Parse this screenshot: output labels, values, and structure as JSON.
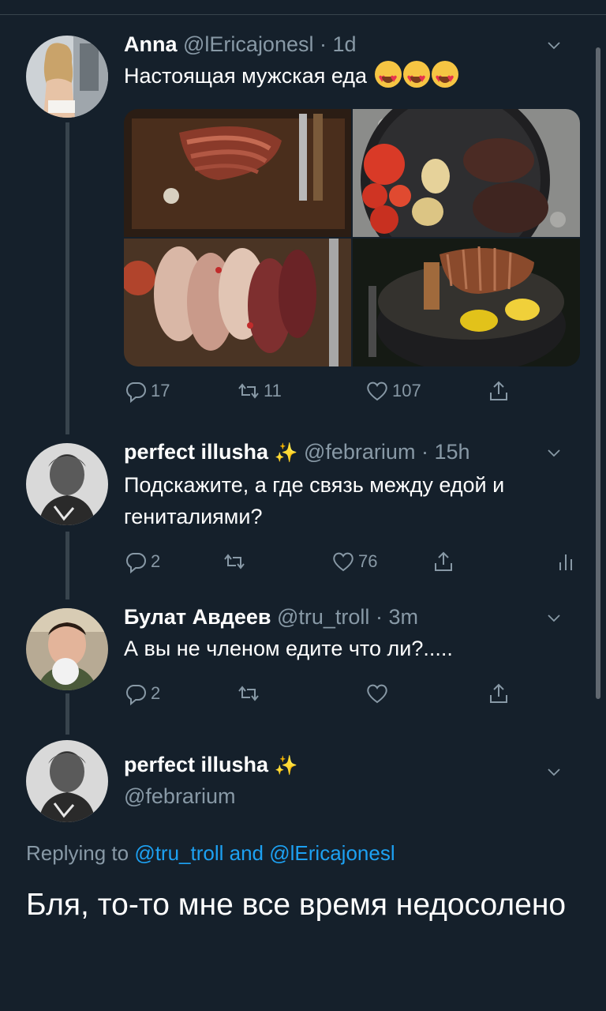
{
  "tweets": [
    {
      "name": "Anna",
      "handle": "@lEricajonesl",
      "time": "1d",
      "text": "Настоящая мужская еда",
      "emojis": [
        "heart-eyes-emoji",
        "heart-eyes-emoji",
        "heart-eyes-emoji"
      ],
      "media": [
        "sliced grilled steak on board",
        "skillet with tomatoes, potatoes and steaks",
        "sliced cured meat platter",
        "roast meat and peppers on grill"
      ],
      "replies": "17",
      "retweets": "11",
      "likes": "107"
    },
    {
      "name": "perfect illusha",
      "sparkle": "✨",
      "handle": "@febrarium",
      "time": "15h",
      "text": "Подскажите, а где связь между едой и гениталиями?",
      "replies": "2",
      "retweets": "",
      "likes": "76"
    },
    {
      "name": "Булат Авдеев",
      "handle": "@tru_troll",
      "time": "3m",
      "text": "А вы не членом едите что ли?.....",
      "replies": "2",
      "retweets": "",
      "likes": ""
    }
  ],
  "focused": {
    "name": "perfect illusha",
    "sparkle": "✨",
    "handle": "@febrarium",
    "replying_label": "Replying to",
    "replying_user1": "@tru_troll",
    "replying_and": "and",
    "replying_user2": "@lEricajonesl",
    "text": "Бля, то-то мне все время недосолено"
  },
  "icons": {
    "reply": "reply-icon",
    "retweet": "retweet-icon",
    "like": "like-icon",
    "share": "share-icon",
    "analytics": "analytics-icon",
    "more": "chevron-down-icon"
  },
  "colors": {
    "background": "#15202b",
    "secondary_text": "#8899a6",
    "link": "#1da1f2",
    "thread_line": "#38444d"
  }
}
